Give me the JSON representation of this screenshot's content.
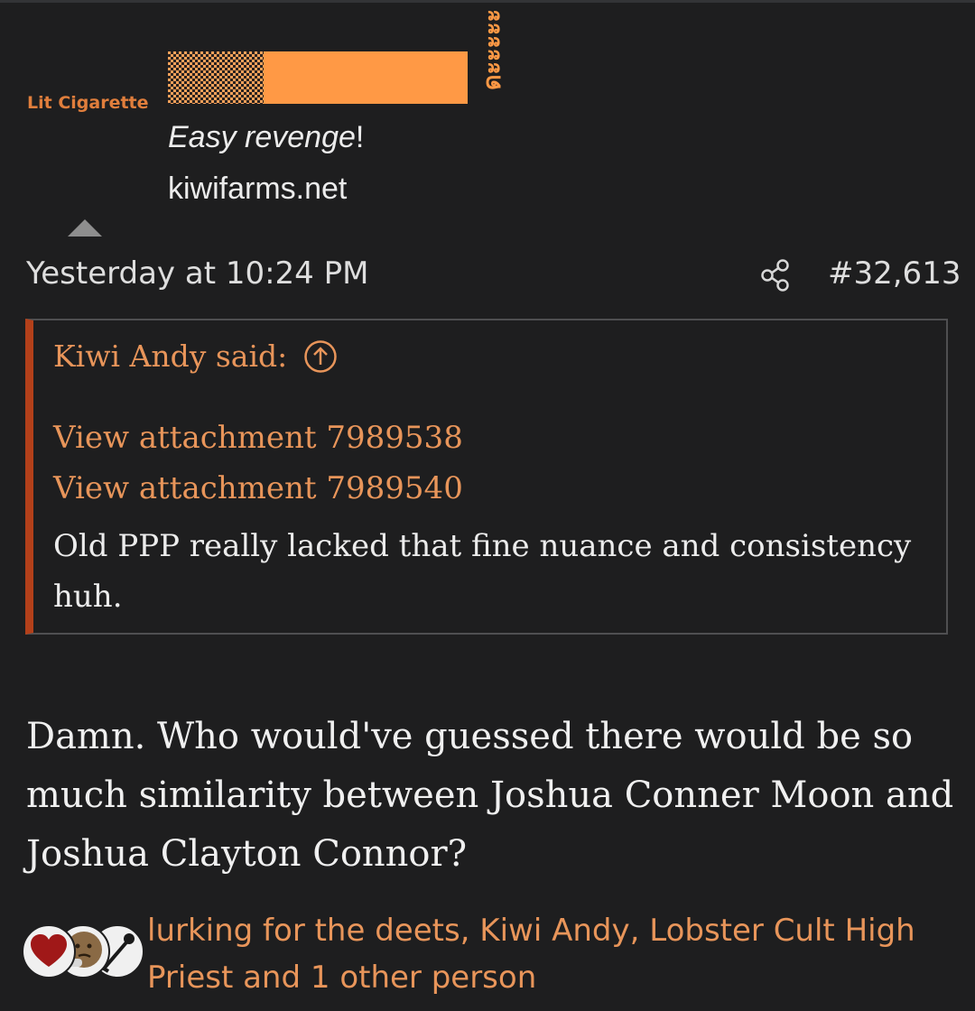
{
  "author": {
    "user_title": "Lit Cigarette"
  },
  "signature": {
    "text_italic": "Easy revenge",
    "text_suffix": "!",
    "link": "kiwifarms.net",
    "image_glyphs": "ดะะะะะ"
  },
  "post": {
    "date": "Yesterday at 10:24 PM",
    "number": "#32,613",
    "quote": {
      "header": "Kiwi Andy said:",
      "attachments": [
        "View attachment 7989538",
        "View attachment 7989540"
      ],
      "body": "Old PPP really lacked that fine nuance and consistency huh."
    },
    "body": "Damn. Who would've guessed there would be so much similarity between Joshua Conner Moon and Joshua Clayton Connor?"
  },
  "reactions": {
    "icons": [
      "heart-icon",
      "thinking-face-icon",
      "mop-icon"
    ],
    "users": "lurking for the deets, Kiwi Andy, Lobster Cult High Priest and 1 other person"
  },
  "colors": {
    "background": "#1e1e1f",
    "accent": "#e8955a",
    "quote_border": "#b3401a",
    "user_title": "#e07e3c"
  }
}
